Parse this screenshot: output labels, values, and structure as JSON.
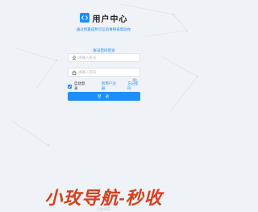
{
  "header": {
    "logo_icon": "code-brackets-icon",
    "title": "用户中心",
    "subtitle": "通过积聚成熟可信的事物来帮助你"
  },
  "login_tabs": [
    {
      "label": "账号密码登录",
      "active": true
    }
  ],
  "form": {
    "username_placeholder": "请输入账号",
    "password_placeholder": "请输入密码",
    "remember_label": "自动登录",
    "remember_checked": true,
    "link_register": "新用户注册",
    "link_forgot": "忘记密码",
    "submit_label": "登 录"
  },
  "footer": {
    "watermark": "小玫导航-秒收",
    "caption": "小玫导航"
  },
  "colors": {
    "accent": "#1e8efb",
    "background": "#eff2f7",
    "watermark": "#d4411f"
  }
}
